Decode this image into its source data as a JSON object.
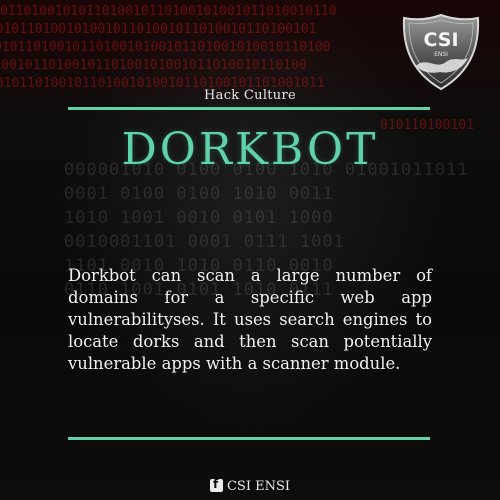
{
  "poster": {
    "category": "Hack Culture",
    "title": "DORKBOT",
    "body": "Dorkbot can scan a large number of domains for a specific web app vulnerabilityses. It uses search engines to locate dorks and then scan potentially vulnerable apps with a scanner module.",
    "footer_label": "CSI ENSI"
  },
  "logo": {
    "main_text": "CSI",
    "sub_text": "ENSI"
  },
  "icons": {
    "footer": "facebook-icon",
    "logo": "csi-ensi-shield-logo"
  },
  "colors": {
    "accent": "#5fd2a8",
    "background": "#0b0b0b",
    "text": "#f2f2f2"
  }
}
